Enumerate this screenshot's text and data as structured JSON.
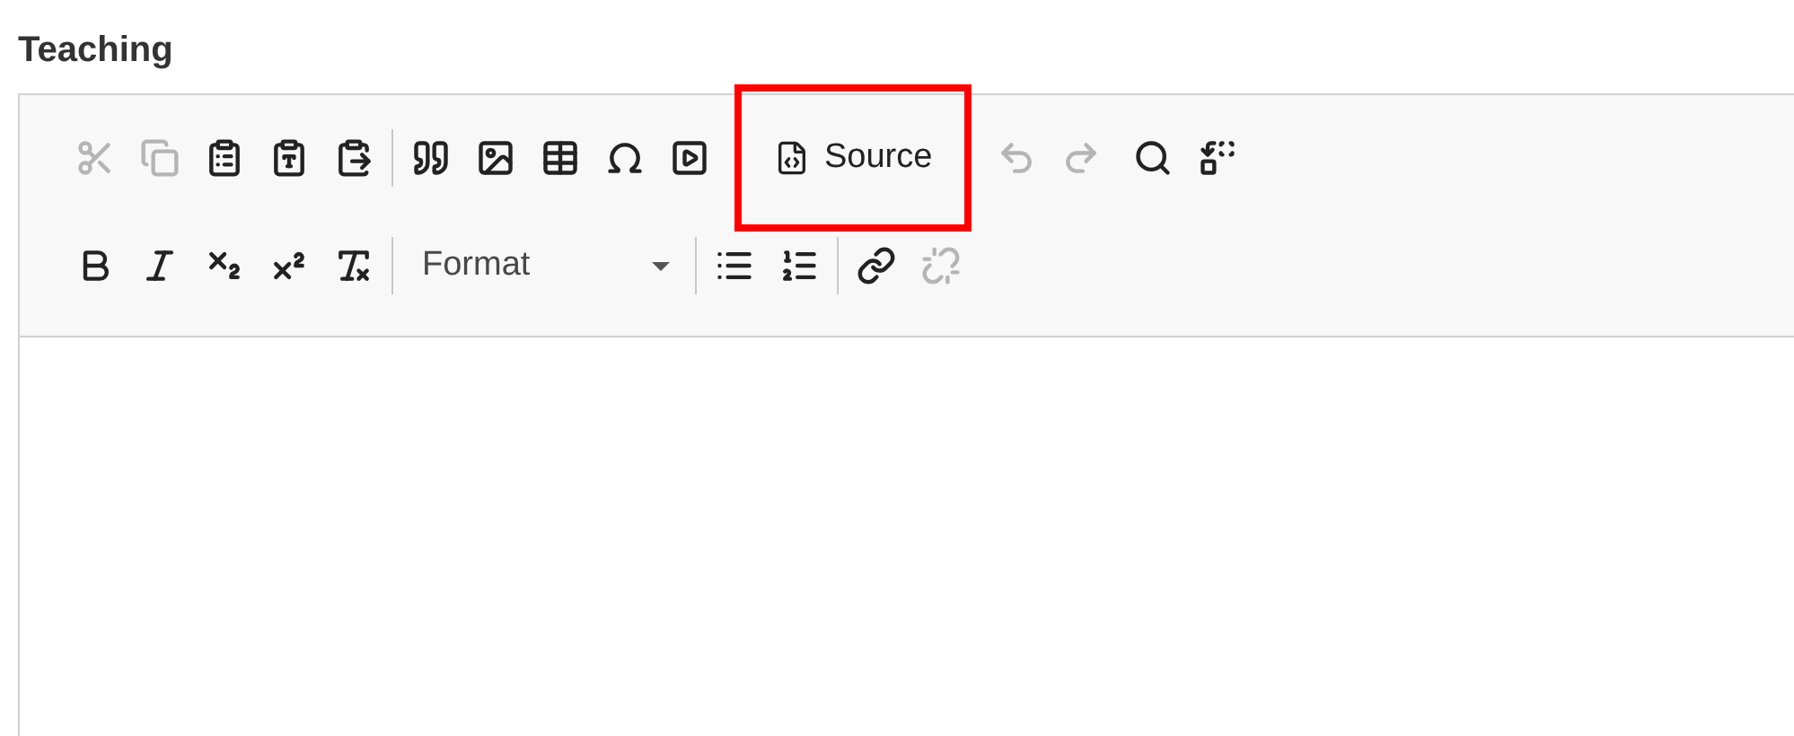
{
  "field": {
    "label": "Teaching"
  },
  "toolbar": {
    "rows": [
      {
        "groups": [
          {
            "separator_before": false,
            "items": [
              {
                "kind": "cut",
                "disabled": true
              },
              {
                "kind": "copy",
                "disabled": true
              },
              {
                "kind": "paste",
                "disabled": false
              },
              {
                "kind": "paste-text",
                "disabled": false
              },
              {
                "kind": "paste-word",
                "disabled": false
              }
            ]
          },
          {
            "separator_before": true,
            "items": [
              {
                "kind": "blockquote",
                "disabled": false
              },
              {
                "kind": "image",
                "disabled": false
              },
              {
                "kind": "table",
                "disabled": false
              },
              {
                "kind": "special-char",
                "disabled": false
              },
              {
                "kind": "media",
                "disabled": false
              }
            ]
          },
          {
            "separator_before": false,
            "items": [
              {
                "kind": "source",
                "label": "Source",
                "disabled": false,
                "highlighted": true
              }
            ]
          },
          {
            "separator_before": false,
            "items": [
              {
                "kind": "undo",
                "disabled": true
              },
              {
                "kind": "redo",
                "disabled": true
              }
            ]
          },
          {
            "separator_before": false,
            "items": [
              {
                "kind": "find",
                "disabled": false
              },
              {
                "kind": "replace",
                "disabled": false
              }
            ]
          }
        ]
      },
      {
        "groups": [
          {
            "separator_before": false,
            "items": [
              {
                "kind": "bold",
                "disabled": false
              },
              {
                "kind": "italic",
                "disabled": false
              },
              {
                "kind": "subscript",
                "disabled": false
              },
              {
                "kind": "superscript",
                "disabled": false
              },
              {
                "kind": "remove-format",
                "disabled": false
              }
            ]
          },
          {
            "separator_before": true,
            "items": [
              {
                "kind": "format",
                "label": "Format",
                "disabled": false
              }
            ]
          },
          {
            "separator_before": true,
            "items": [
              {
                "kind": "bulleted-list",
                "disabled": false
              },
              {
                "kind": "numbered-list",
                "disabled": false
              }
            ]
          },
          {
            "separator_before": true,
            "items": [
              {
                "kind": "link",
                "disabled": false
              },
              {
                "kind": "unlink",
                "disabled": true
              }
            ]
          }
        ]
      }
    ]
  }
}
